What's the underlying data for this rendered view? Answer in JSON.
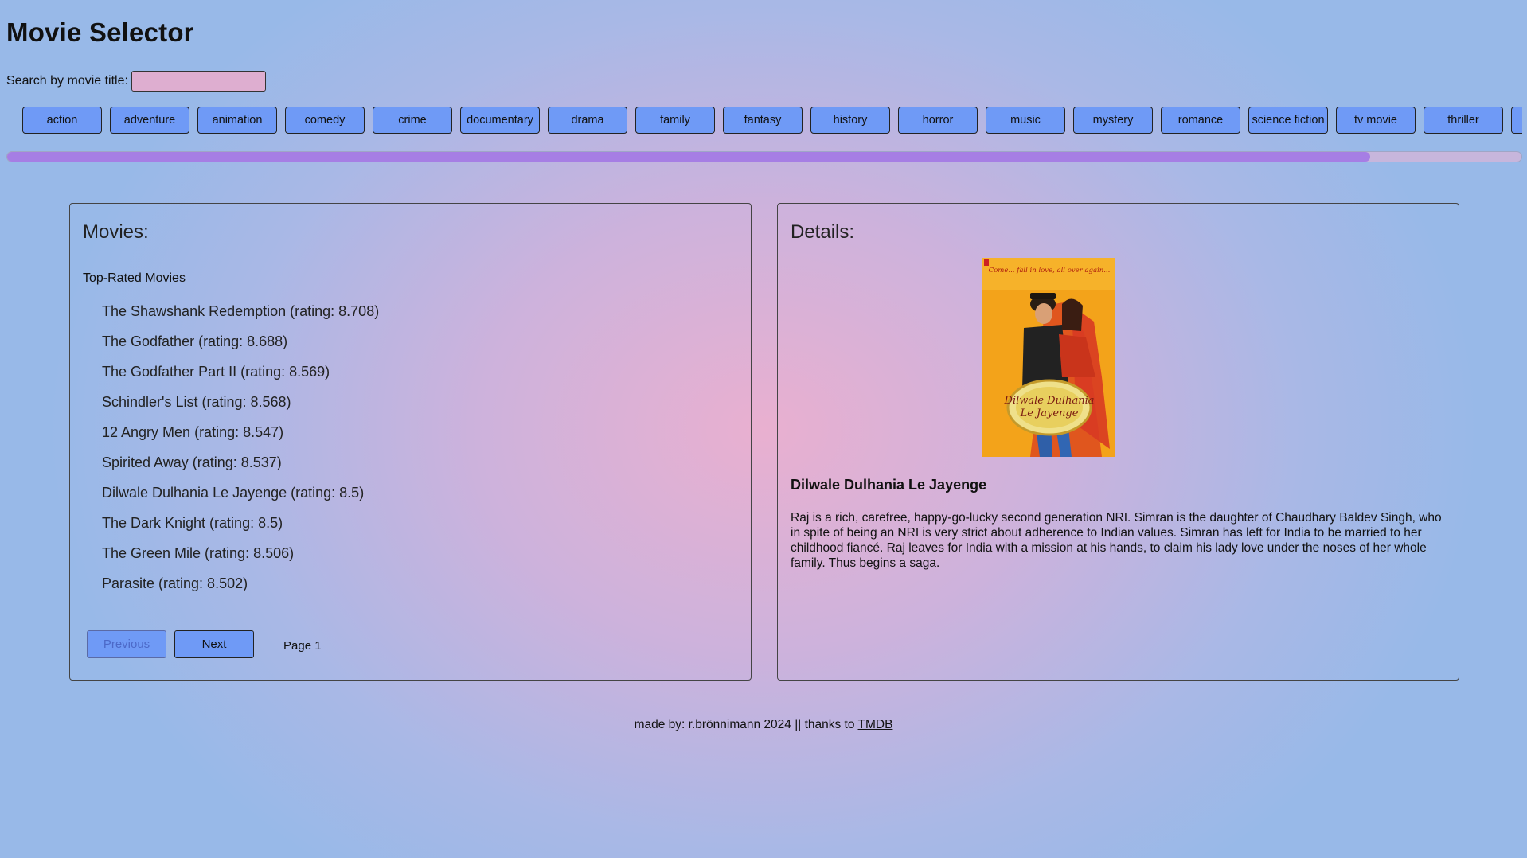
{
  "app": {
    "title": "Movie Selector"
  },
  "search": {
    "label": "Search by movie title:",
    "value": "",
    "placeholder": ""
  },
  "genres": [
    "action",
    "adventure",
    "animation",
    "comedy",
    "crime",
    "documentary",
    "drama",
    "family",
    "fantasy",
    "history",
    "horror",
    "music",
    "mystery",
    "romance",
    "science fiction",
    "tv movie",
    "thriller"
  ],
  "genre_scroll": {
    "visible_fraction": 0.9
  },
  "movies_panel": {
    "heading": "Movies:",
    "list_title": "Top-Rated Movies",
    "items": [
      "The Shawshank Redemption (rating: 8.708)",
      "The Godfather (rating: 8.688)",
      "The Godfather Part II (rating: 8.569)",
      "Schindler's List (rating: 8.568)",
      "12 Angry Men (rating: 8.547)",
      "Spirited Away (rating: 8.537)",
      "Dilwale Dulhania Le Jayenge (rating: 8.5)",
      "The Dark Knight (rating: 8.5)",
      "The Green Mile (rating: 8.506)",
      "Parasite (rating: 8.502)"
    ],
    "pager": {
      "previous_label": "Previous",
      "next_label": "Next",
      "page_text": "Page 1"
    }
  },
  "details_panel": {
    "heading": "Details:",
    "poster": {
      "tagline": "Come... fall in love, all over again...",
      "logo_line1": "Dilwale Dulhania",
      "logo_line2": "Le Jayenge"
    },
    "title": "Dilwale Dulhania Le Jayenge",
    "overview": "Raj is a rich, carefree, happy-go-lucky second generation NRI. Simran is the daughter of Chaudhary Baldev Singh, who in spite of being an NRI is very strict about adherence to Indian values. Simran has left for India to be married to her childhood fiancé. Raj leaves for India with a mission at his hands, to claim his lady love under the noses of her whole family. Thus begins a saga."
  },
  "footer": {
    "text": "made by: r.brönnimann 2024 || thanks to ",
    "link_text": "TMDB"
  },
  "colors": {
    "button": "#6f9af6",
    "scroll_thumb": "#a67ee4",
    "search_bg": "#deaed0",
    "poster_bg": "#f4a516"
  }
}
